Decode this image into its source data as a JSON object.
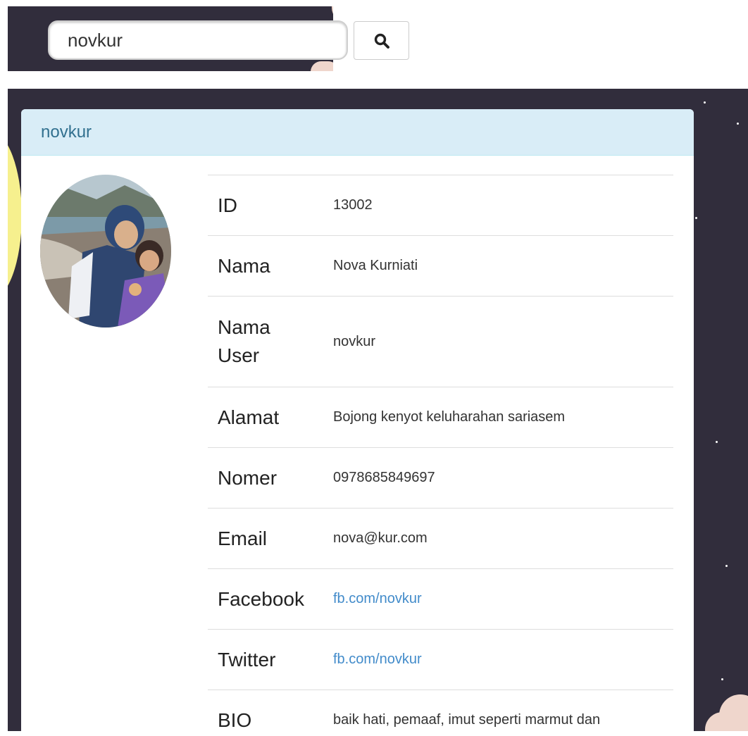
{
  "search": {
    "value": "novkur",
    "icon": "search-icon"
  },
  "profile": {
    "panel_title": "novkur",
    "avatar": "profile-photo",
    "fields": {
      "id": {
        "label": "ID",
        "value": "13002"
      },
      "name": {
        "label": "Nama",
        "value": "Nova Kurniati"
      },
      "username": {
        "label_line1": "Nama",
        "label_line2": "User",
        "value": "novkur"
      },
      "address": {
        "label": "Alamat",
        "value": "Bojong kenyot keluharahan sariasem"
      },
      "phone": {
        "label": "Nomer",
        "value": "0978685849697"
      },
      "email": {
        "label": "Email",
        "value": "nova@kur.com"
      },
      "facebook": {
        "label": "Facebook",
        "value": "fb.com/novkur"
      },
      "twitter": {
        "label": "Twitter",
        "value": "fb.com/novkur"
      },
      "bio": {
        "label": "BIO",
        "value": "baik hati, pemaaf, imut seperti marmut dan"
      }
    }
  },
  "colors": {
    "background": "#312d3c",
    "panel_heading_bg": "#d9edf7",
    "panel_heading_text": "#31708f",
    "link": "#428bca"
  }
}
